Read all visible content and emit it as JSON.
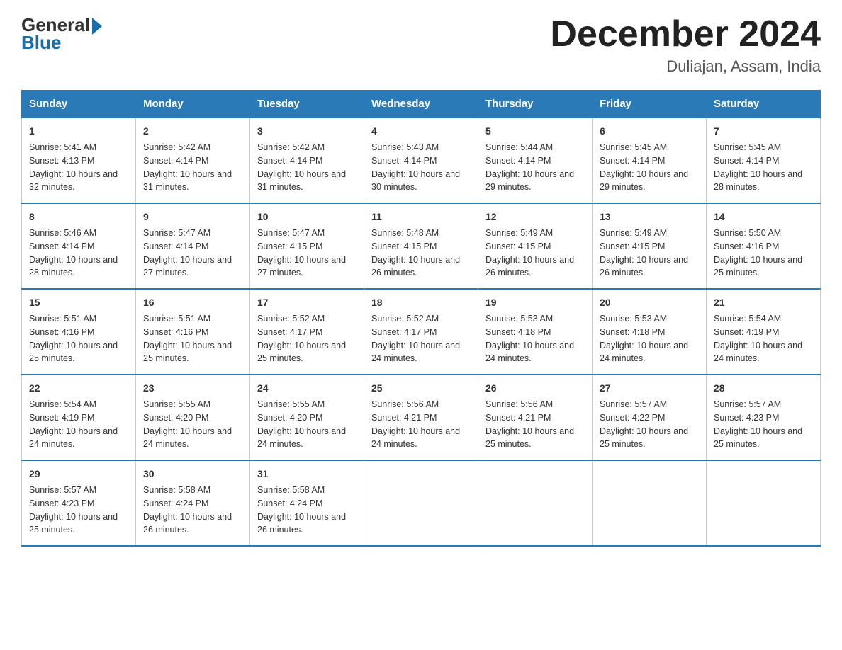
{
  "header": {
    "logo": {
      "general": "General",
      "blue": "Blue"
    },
    "title": "December 2024",
    "location": "Duliajan, Assam, India"
  },
  "weekdays": [
    "Sunday",
    "Monday",
    "Tuesday",
    "Wednesday",
    "Thursday",
    "Friday",
    "Saturday"
  ],
  "weeks": [
    [
      {
        "day": "1",
        "sunrise": "5:41 AM",
        "sunset": "4:13 PM",
        "daylight": "10 hours and 32 minutes."
      },
      {
        "day": "2",
        "sunrise": "5:42 AM",
        "sunset": "4:14 PM",
        "daylight": "10 hours and 31 minutes."
      },
      {
        "day": "3",
        "sunrise": "5:42 AM",
        "sunset": "4:14 PM",
        "daylight": "10 hours and 31 minutes."
      },
      {
        "day": "4",
        "sunrise": "5:43 AM",
        "sunset": "4:14 PM",
        "daylight": "10 hours and 30 minutes."
      },
      {
        "day": "5",
        "sunrise": "5:44 AM",
        "sunset": "4:14 PM",
        "daylight": "10 hours and 29 minutes."
      },
      {
        "day": "6",
        "sunrise": "5:45 AM",
        "sunset": "4:14 PM",
        "daylight": "10 hours and 29 minutes."
      },
      {
        "day": "7",
        "sunrise": "5:45 AM",
        "sunset": "4:14 PM",
        "daylight": "10 hours and 28 minutes."
      }
    ],
    [
      {
        "day": "8",
        "sunrise": "5:46 AM",
        "sunset": "4:14 PM",
        "daylight": "10 hours and 28 minutes."
      },
      {
        "day": "9",
        "sunrise": "5:47 AM",
        "sunset": "4:14 PM",
        "daylight": "10 hours and 27 minutes."
      },
      {
        "day": "10",
        "sunrise": "5:47 AM",
        "sunset": "4:15 PM",
        "daylight": "10 hours and 27 minutes."
      },
      {
        "day": "11",
        "sunrise": "5:48 AM",
        "sunset": "4:15 PM",
        "daylight": "10 hours and 26 minutes."
      },
      {
        "day": "12",
        "sunrise": "5:49 AM",
        "sunset": "4:15 PM",
        "daylight": "10 hours and 26 minutes."
      },
      {
        "day": "13",
        "sunrise": "5:49 AM",
        "sunset": "4:15 PM",
        "daylight": "10 hours and 26 minutes."
      },
      {
        "day": "14",
        "sunrise": "5:50 AM",
        "sunset": "4:16 PM",
        "daylight": "10 hours and 25 minutes."
      }
    ],
    [
      {
        "day": "15",
        "sunrise": "5:51 AM",
        "sunset": "4:16 PM",
        "daylight": "10 hours and 25 minutes."
      },
      {
        "day": "16",
        "sunrise": "5:51 AM",
        "sunset": "4:16 PM",
        "daylight": "10 hours and 25 minutes."
      },
      {
        "day": "17",
        "sunrise": "5:52 AM",
        "sunset": "4:17 PM",
        "daylight": "10 hours and 25 minutes."
      },
      {
        "day": "18",
        "sunrise": "5:52 AM",
        "sunset": "4:17 PM",
        "daylight": "10 hours and 24 minutes."
      },
      {
        "day": "19",
        "sunrise": "5:53 AM",
        "sunset": "4:18 PM",
        "daylight": "10 hours and 24 minutes."
      },
      {
        "day": "20",
        "sunrise": "5:53 AM",
        "sunset": "4:18 PM",
        "daylight": "10 hours and 24 minutes."
      },
      {
        "day": "21",
        "sunrise": "5:54 AM",
        "sunset": "4:19 PM",
        "daylight": "10 hours and 24 minutes."
      }
    ],
    [
      {
        "day": "22",
        "sunrise": "5:54 AM",
        "sunset": "4:19 PM",
        "daylight": "10 hours and 24 minutes."
      },
      {
        "day": "23",
        "sunrise": "5:55 AM",
        "sunset": "4:20 PM",
        "daylight": "10 hours and 24 minutes."
      },
      {
        "day": "24",
        "sunrise": "5:55 AM",
        "sunset": "4:20 PM",
        "daylight": "10 hours and 24 minutes."
      },
      {
        "day": "25",
        "sunrise": "5:56 AM",
        "sunset": "4:21 PM",
        "daylight": "10 hours and 24 minutes."
      },
      {
        "day": "26",
        "sunrise": "5:56 AM",
        "sunset": "4:21 PM",
        "daylight": "10 hours and 25 minutes."
      },
      {
        "day": "27",
        "sunrise": "5:57 AM",
        "sunset": "4:22 PM",
        "daylight": "10 hours and 25 minutes."
      },
      {
        "day": "28",
        "sunrise": "5:57 AM",
        "sunset": "4:23 PM",
        "daylight": "10 hours and 25 minutes."
      }
    ],
    [
      {
        "day": "29",
        "sunrise": "5:57 AM",
        "sunset": "4:23 PM",
        "daylight": "10 hours and 25 minutes."
      },
      {
        "day": "30",
        "sunrise": "5:58 AM",
        "sunset": "4:24 PM",
        "daylight": "10 hours and 26 minutes."
      },
      {
        "day": "31",
        "sunrise": "5:58 AM",
        "sunset": "4:24 PM",
        "daylight": "10 hours and 26 minutes."
      },
      null,
      null,
      null,
      null
    ]
  ],
  "labels": {
    "sunrise": "Sunrise:",
    "sunset": "Sunset:",
    "daylight": "Daylight:"
  }
}
